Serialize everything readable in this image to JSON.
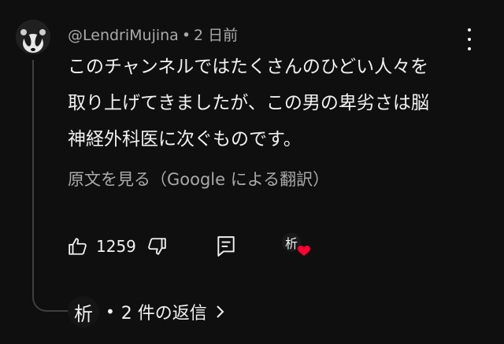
{
  "comment": {
    "author": "@LendriMujina",
    "separator": "•",
    "time": "2 日前",
    "lines": [
      "このチャンネルではたくさんのひどい人々を",
      "取り上げてきましたが、この男の卑劣さは脳",
      "神経外科医に次ぐものです。"
    ],
    "translate_label": "原文を見る（Google による翻訳）",
    "like_count": "1259",
    "heart_avatar_glyph": "析"
  },
  "replies": {
    "avatar_glyph": "析",
    "separator": "•",
    "label": "2 件の返信"
  },
  "colors": {
    "background": "#0f0f0f",
    "text": "#f1f1f1",
    "secondary": "#aaaaaa",
    "heart": "#ff0033"
  },
  "icons": [
    "badger-avatar",
    "more-vert-icon",
    "thumb-up-icon",
    "thumb-down-icon",
    "reply-icon",
    "creator-heart-icon",
    "chevron-right-icon"
  ]
}
